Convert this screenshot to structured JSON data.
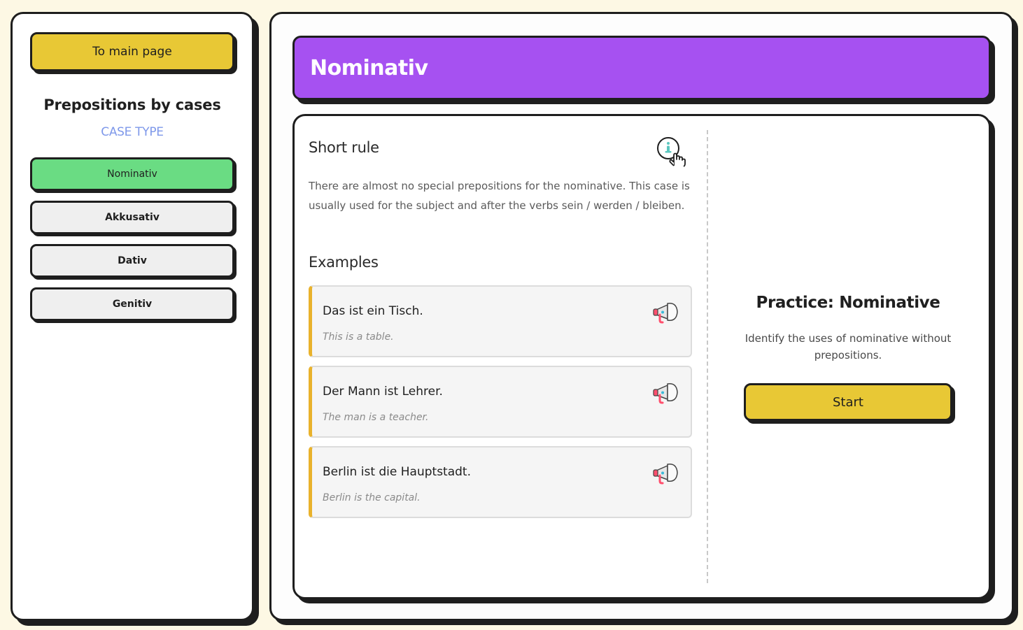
{
  "sidebar": {
    "main_page_label": "To main page",
    "title": "Prepositions by cases",
    "subtitle": "CASE TYPE",
    "cases": [
      {
        "label": "Nominativ",
        "active": true
      },
      {
        "label": "Akkusativ",
        "active": false
      },
      {
        "label": "Dativ",
        "active": false
      },
      {
        "label": "Genitiv",
        "active": false
      }
    ]
  },
  "main": {
    "title": "Nominativ",
    "short_rule_heading": "Short rule",
    "info_icon": "info-pointer-icon",
    "rule_text": "There are almost no special prepositions for the nominative. This case is usually used for the subject and after the verbs sein / werden / bleiben.",
    "examples_heading": "Examples",
    "speaker_icon": "megaphone-icon",
    "examples": [
      {
        "de": "Das ist ein Tisch.",
        "en": "This is a table."
      },
      {
        "de": "Der Mann ist Lehrer.",
        "en": "The man is a teacher."
      },
      {
        "de": "Berlin ist die Hauptstadt.",
        "en": "Berlin is the capital."
      }
    ],
    "practice_title": "Practice: Nominative",
    "practice_desc": "Identify the uses of nominative without prepositions.",
    "start_label": "Start"
  },
  "colors": {
    "background": "#fdf8e4",
    "accent_yellow": "#e8c835",
    "banner_purple": "#a651f1",
    "active_green": "#6adc83",
    "subtitle_blue": "#7e98ea",
    "example_border": "#e9b22c"
  }
}
